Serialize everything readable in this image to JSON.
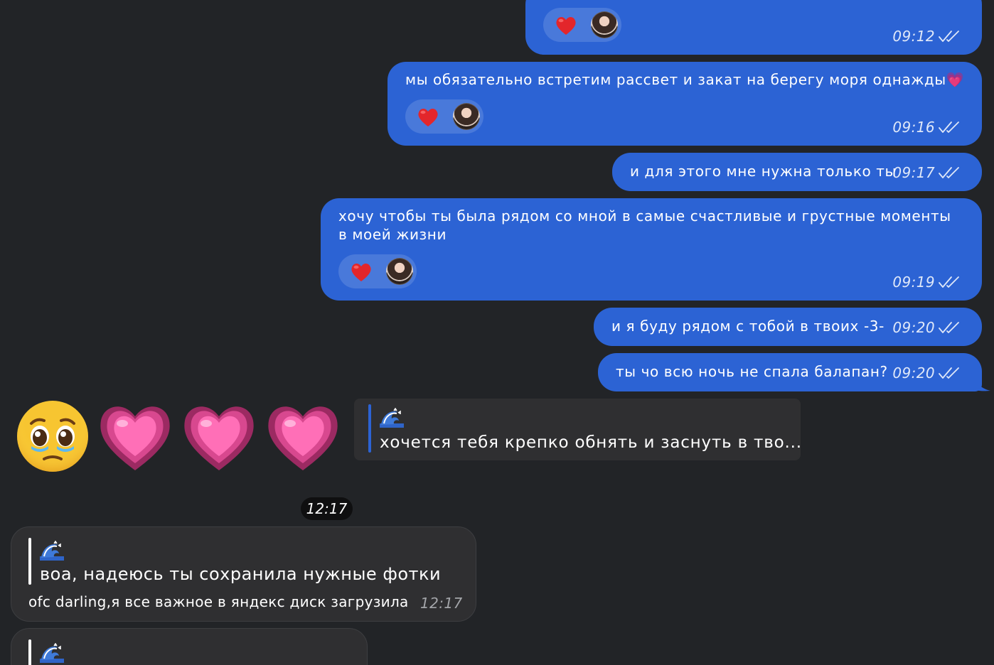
{
  "colors": {
    "background": "#222427",
    "outgoing_bubble": "#2c63d4",
    "incoming_bubble": "#2f2f31",
    "reaction_heart": "#e3262b",
    "reply_accent": "#2c63d4"
  },
  "outgoing_messages": [
    {
      "text": "",
      "time": "09:12",
      "status": "read",
      "reactions": [
        "heart",
        "avatar"
      ]
    },
    {
      "text": "мы обязательно встретим рассвет и закат на берегу моря однажды💗",
      "time": "09:16",
      "status": "read",
      "reactions": [
        "heart",
        "avatar"
      ]
    },
    {
      "text": "и для этого мне нужна только ты",
      "time": "09:17",
      "status": "read"
    },
    {
      "text": "хочу чтобы ты была рядом со мной в самые счастливые и грустные моменты в моей жизни",
      "time": "09:19",
      "status": "read",
      "reactions": [
        "heart",
        "avatar"
      ]
    },
    {
      "text": "и я буду рядом с тобой в твоих -3-",
      "time": "09:20",
      "status": "read"
    },
    {
      "text": "ты чо всю ночь не спала балапан?",
      "time": "09:20",
      "status": "read"
    }
  ],
  "emoji_message": {
    "icons": [
      "pleading-face-icon",
      "growing-heart-icon",
      "growing-heart-icon",
      "growing-heart-icon"
    ],
    "reply_preview": {
      "author": "🌊",
      "text": "хочется тебя крепко обнять и заснуть в тво..."
    }
  },
  "date_separator": "12:17",
  "incoming_messages": [
    {
      "quote_author": "🌊",
      "quote_text": "воа, надеюсь ты сохранила нужные фотки",
      "text": "ofc darling,я все важное в яндекс диск загрузила",
      "time": "12:17"
    },
    {
      "quote_author": "🌊"
    }
  ]
}
